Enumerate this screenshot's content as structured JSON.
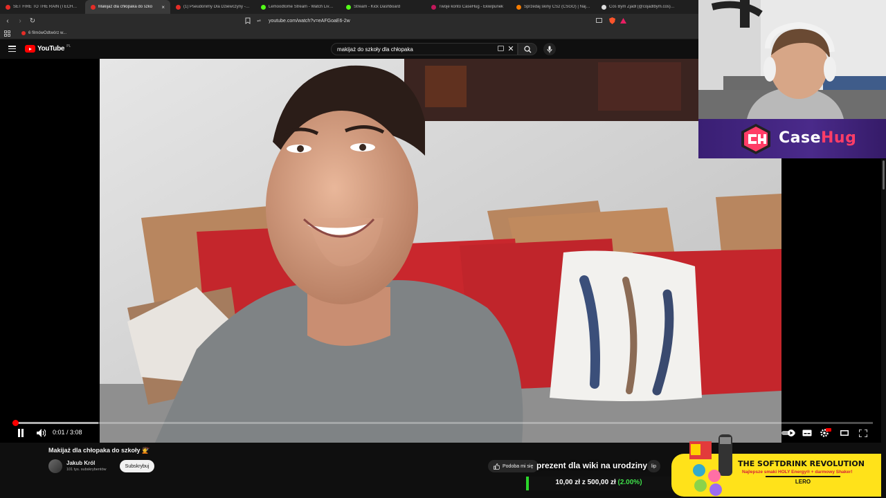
{
  "browser": {
    "tabs": [
      {
        "title": "SET FIRE TO THE RAIN (TECHNO) - Y",
        "favicon_color": "#e52d27",
        "active": false
      },
      {
        "title": "Makijaż dla chłopaka do szko",
        "favicon_color": "#e52d27",
        "active": true
      },
      {
        "title": "(1) Pseudonimy Dla Dziewczyny - 34",
        "favicon_color": "#e52d27",
        "active": false
      },
      {
        "title": "Lemoodtome Stream - Watch Live on",
        "favicon_color": "#53fc18",
        "active": false
      },
      {
        "title": "Stream - Kick Dashboard",
        "favicon_color": "#53fc18",
        "active": false
      },
      {
        "title": "Twoje konto CaseHug - Ekwipunek",
        "favicon_color": "#c2185b",
        "active": false
      },
      {
        "title": "Sprzedaj skiny CS2 (CSGO) | Najlep",
        "favicon_color": "#f57c00",
        "active": false
      },
      {
        "title": "Coś Bym Zjadł (@cojadlbym.cos) | Tik",
        "favicon_color": "#dddddd",
        "active": false
      }
    ],
    "tab_close": "×",
    "url": "youtube.com/watch?v=eAFGoaE6-2w",
    "bookmark": "6 filmówOdtwórz w..."
  },
  "youtube": {
    "logo_text": "YouTube",
    "logo_country": "PL",
    "search_query": "makijaż do szkoły dla chłopaka",
    "clear_icon": "✕"
  },
  "player": {
    "time": "0:01 / 3:08",
    "progress_fraction": 0.003,
    "buffered_fraction": 0.1
  },
  "video": {
    "title": "Makijaż dla chłopaka do szkoły 💇",
    "channel": "Jakub Król",
    "subscribers": "101 tys. subskrybentów",
    "subscribe_label": "Subskrybuj",
    "like_label": "Podoba mi się",
    "clip_label": "lip"
  },
  "overlay": {
    "goal_title": "prezent dla wiki na urodziny",
    "goal_amount": "10,00 zł z 500,00 zł",
    "goal_percent": "(2.00%)",
    "goal_fraction": 0.02,
    "casehug_name_a": "Case",
    "casehug_name_b": "Hug",
    "ad_headline": "THE SOFTDRINK REVOLUTION",
    "ad_sub": "Najlepsze smaki HOLY Energy® + darmowy Shaker!",
    "ad_code": "LERO"
  },
  "colors": {
    "yt_red": "#ff0000",
    "casehug_purple": "#4a2a8a",
    "casehug_pink": "#ff3d67",
    "ad_yellow": "#ffe21a",
    "goal_green": "#2bd62b"
  }
}
